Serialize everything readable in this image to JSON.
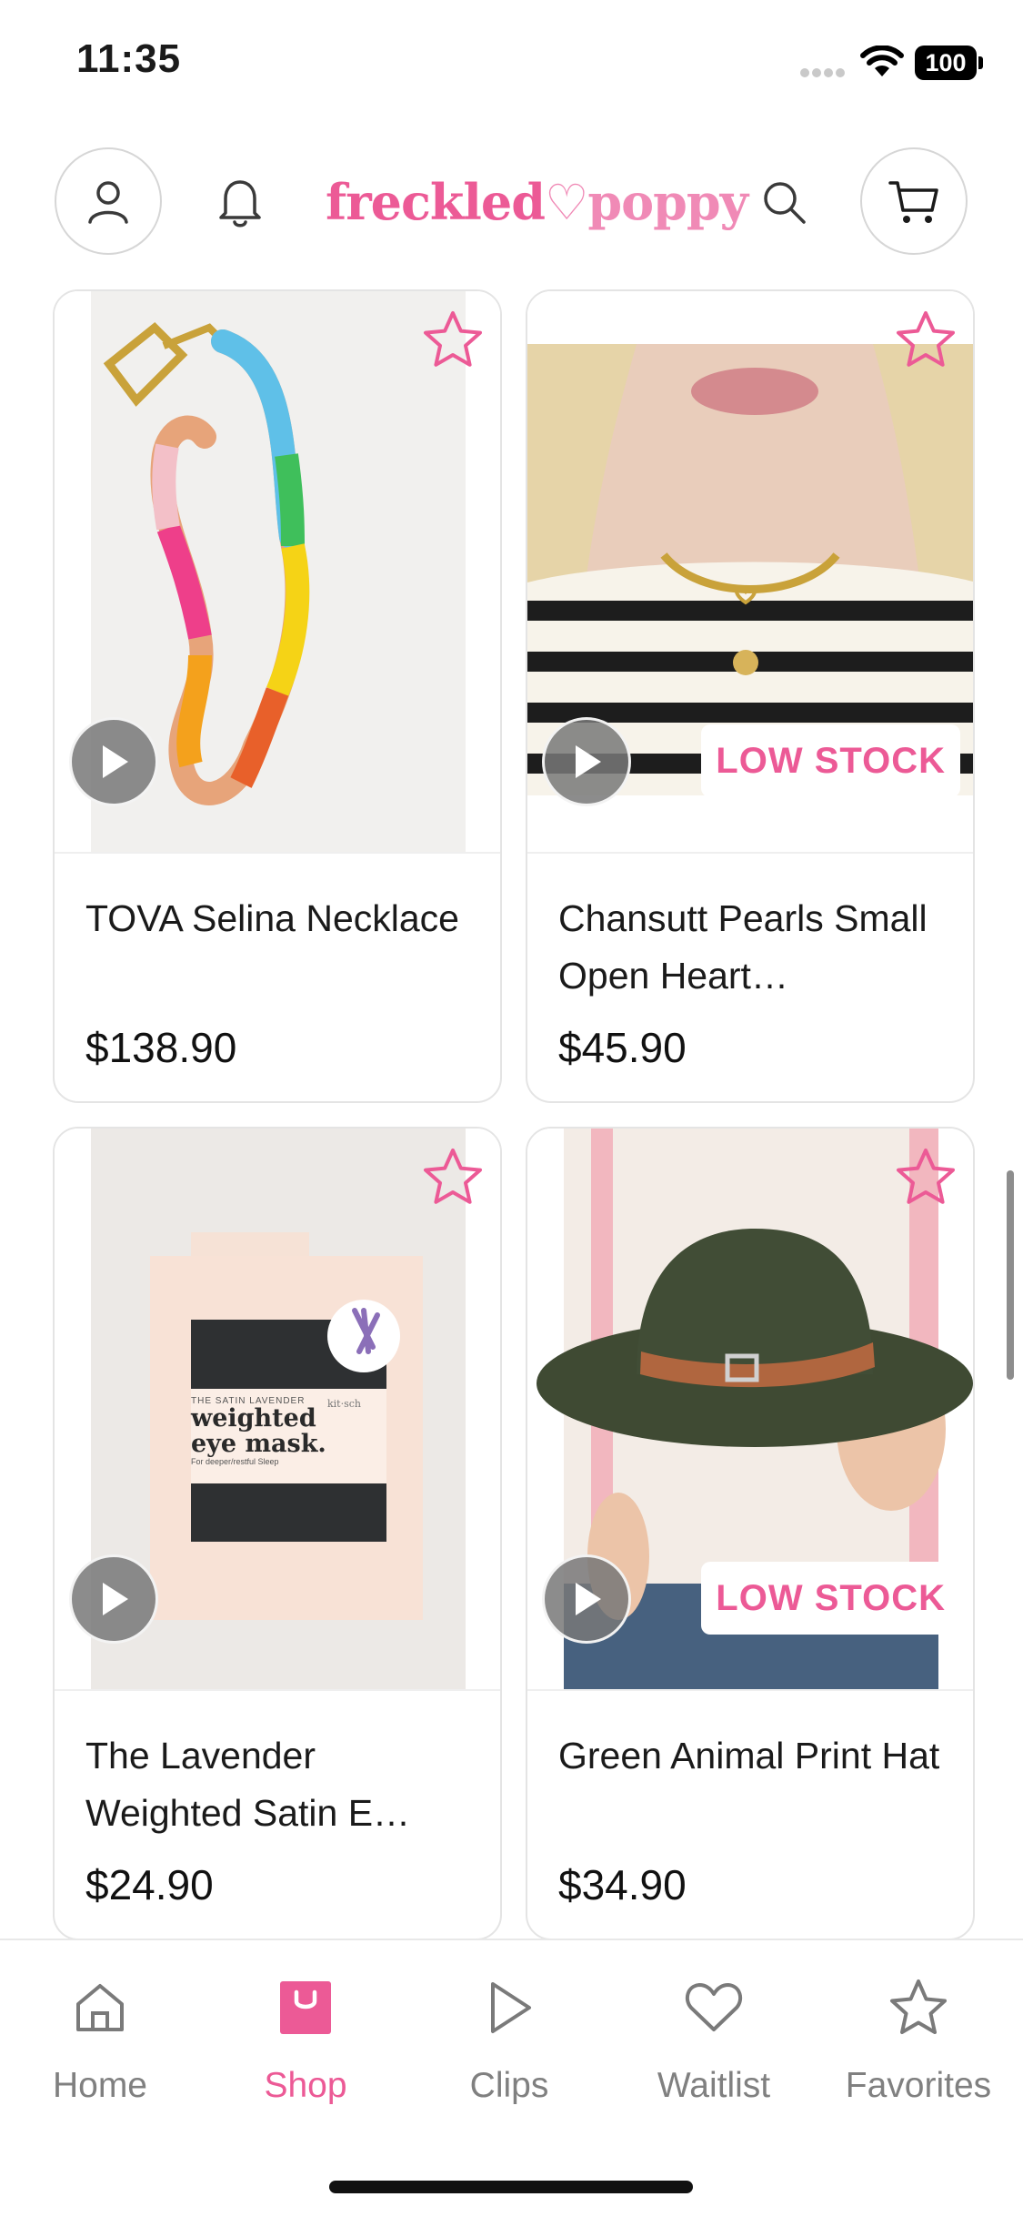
{
  "status_bar": {
    "time": "11:35",
    "battery": "100"
  },
  "header": {
    "logo_part1": "freckled",
    "logo_heart": "♡",
    "logo_part2": "poppy",
    "icons": [
      "user-icon",
      "bell-icon",
      "search-icon",
      "cart-icon"
    ]
  },
  "products": [
    {
      "title": "TOVA Selina Necklace",
      "price": "$138.90",
      "badge": ""
    },
    {
      "title": "Chansutt Pearls Small Open Heart…",
      "price": "$45.90",
      "badge": "LOW STOCK"
    },
    {
      "title": "The Lavender Weighted Satin E…",
      "price": "$24.90",
      "badge": ""
    },
    {
      "title": "Green Animal Print Hat",
      "price": "$34.90",
      "badge": "LOW STOCK"
    }
  ],
  "product_image_text": {
    "box_small": "THE SATIN LAVENDER",
    "box_title_1": "weighted",
    "box_title_2": "eye mask.",
    "box_brand": "kit·sch",
    "box_sub": "For deeper/restful Sleep"
  },
  "tabs": [
    {
      "label": "Home",
      "icon": "home-icon",
      "active": false
    },
    {
      "label": "Shop",
      "icon": "shopping-bag-icon",
      "active": true
    },
    {
      "label": "Clips",
      "icon": "play-icon",
      "active": false
    },
    {
      "label": "Waitlist",
      "icon": "heart-icon",
      "active": false
    },
    {
      "label": "Favorites",
      "icon": "star-icon",
      "active": false
    }
  ],
  "colors": {
    "accent": "#ec5a96",
    "inactive": "#808080",
    "border": "#e4e4e4"
  }
}
